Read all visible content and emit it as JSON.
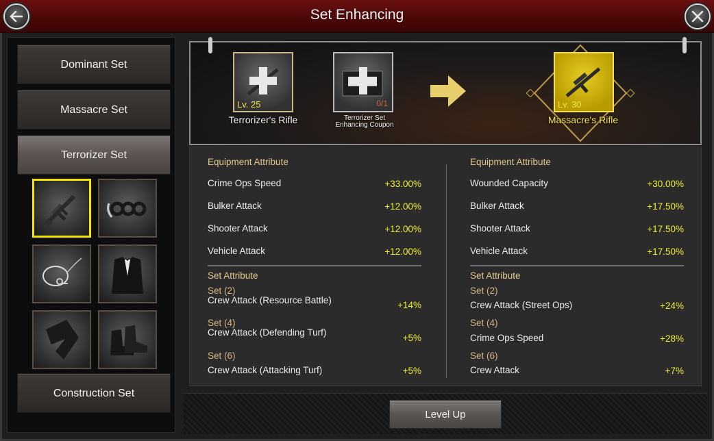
{
  "window": {
    "title": "Set Enhancing",
    "back_icon": "back-arrow-icon",
    "close_icon": "close-icon"
  },
  "sidebar": {
    "sets": [
      {
        "label": "Dominant Set",
        "active": false
      },
      {
        "label": "Massacre Set",
        "active": false
      },
      {
        "label": "Terrorizer Set",
        "active": true
      },
      {
        "label": "Construction Set",
        "active": false
      }
    ],
    "slots": [
      {
        "icon": "rifle-icon",
        "selected": true
      },
      {
        "icon": "brass-knuckles-icon",
        "selected": false
      },
      {
        "icon": "key-chain-icon",
        "selected": false
      },
      {
        "icon": "tuxedo-jacket-icon",
        "selected": false
      },
      {
        "icon": "pants-icon",
        "selected": false
      },
      {
        "icon": "boots-icon",
        "selected": false
      }
    ]
  },
  "upgrade": {
    "source": {
      "level": "Lv. 25",
      "name": "Terrorizer's Rifle"
    },
    "material": {
      "count": "0/1",
      "name": "Terrorizer Set Enhancing Coupon"
    },
    "result": {
      "level": "Lv. 30",
      "name": "Massacre's Rifle"
    }
  },
  "current": {
    "equip_header": "Equipment Attribute",
    "equip": [
      {
        "label": "Crime Ops Speed",
        "value": "+33.00%"
      },
      {
        "label": "Bulker Attack",
        "value": "+12.00%"
      },
      {
        "label": "Shooter Attack",
        "value": "+12.00%"
      },
      {
        "label": "Vehicle Attack",
        "value": "+12.00%"
      }
    ],
    "set_header": "Set Attribute",
    "sets": [
      {
        "set": "Set (2)",
        "label": "Crew Attack (Resource Battle)",
        "value": "+14%"
      },
      {
        "set": "Set (4)",
        "label": "Crew Attack (Defending Turf)",
        "value": "+5%"
      },
      {
        "set": "Set (6)",
        "label": "Crew Attack (Attacking Turf)",
        "value": "+5%"
      }
    ]
  },
  "next": {
    "equip_header": "Equipment Attribute",
    "equip": [
      {
        "label": "Wounded Capacity",
        "value": "+30.00%"
      },
      {
        "label": "Bulker Attack",
        "value": "+17.50%"
      },
      {
        "label": "Shooter Attack",
        "value": "+17.50%"
      },
      {
        "label": "Vehicle Attack",
        "value": "+17.50%"
      }
    ],
    "set_header": "Set Attribute",
    "sets": [
      {
        "set": "Set (2)",
        "label": "Crew Attack (Street Ops)",
        "value": "+24%"
      },
      {
        "set": "Set (4)",
        "label": "Crime Ops Speed",
        "value": "+28%"
      },
      {
        "set": "Set (6)",
        "label": "Crew Attack",
        "value": "+7%"
      }
    ]
  },
  "actions": {
    "level_up": "Level Up"
  },
  "colors": {
    "accent_yellow": "#f0ec30",
    "header_gold": "#e6c689",
    "title_red": "#5a0b0b"
  }
}
